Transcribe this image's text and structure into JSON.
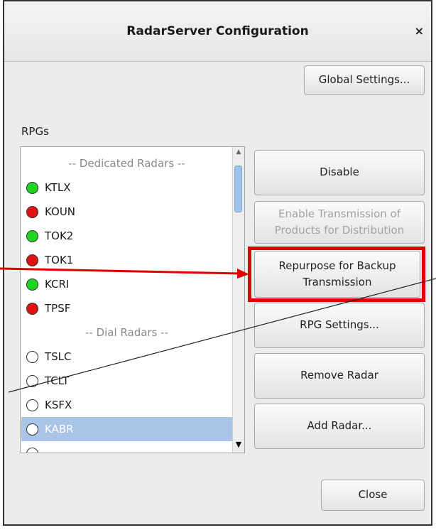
{
  "window": {
    "title": "RadarServer Configuration",
    "close_glyph": "×"
  },
  "buttons": {
    "global_settings": "Global Settings...",
    "disable": "Disable",
    "enable_transmission": "Enable Transmission of Products for Distribution",
    "repurpose": "Repurpose for Backup Transmission",
    "rpg_settings": "RPG Settings...",
    "remove_radar": "Remove Radar",
    "add_radar": "Add Radar...",
    "close": "Close"
  },
  "rpg_list": {
    "label": "RPGs",
    "headers": {
      "dedicated": "-- Dedicated Radars --",
      "dial": "-- Dial Radars --"
    },
    "dedicated": [
      {
        "name": "KTLX",
        "status": "green"
      },
      {
        "name": "KOUN",
        "status": "red"
      },
      {
        "name": "TOK2",
        "status": "green"
      },
      {
        "name": "TOK1",
        "status": "red"
      },
      {
        "name": "KCRI",
        "status": "green"
      },
      {
        "name": "TPSF",
        "status": "red"
      }
    ],
    "dial": [
      {
        "name": "TSLC",
        "status": "white"
      },
      {
        "name": "TCLT",
        "status": "white"
      },
      {
        "name": "KSFX",
        "status": "white"
      },
      {
        "name": "KABR",
        "status": "white",
        "selected": true
      }
    ]
  },
  "colors": {
    "status_green": "#1fd51f",
    "status_red": "#e01111",
    "highlight_red": "#e00000",
    "selection": "#a9c4e6"
  }
}
